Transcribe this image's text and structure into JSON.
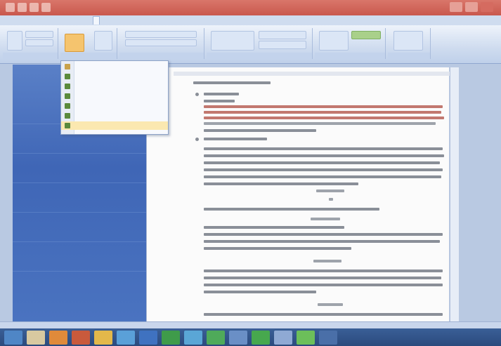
{
  "window": {
    "title": "",
    "quick_access_icons": [
      "save-icon",
      "undo-icon",
      "redo-icon",
      "print-icon"
    ]
  },
  "ribbon": {
    "tabs": [
      {
        "label": "",
        "name": "tab-home"
      },
      {
        "label": "",
        "name": "tab-insert"
      },
      {
        "label": "",
        "name": "tab-page-layout"
      },
      {
        "label": "",
        "name": "tab-references"
      },
      {
        "label": "",
        "name": "tab-mailings"
      },
      {
        "label": "",
        "name": "tab-review"
      },
      {
        "label": "",
        "name": "tab-view"
      }
    ],
    "active_tab_index": 4
  },
  "dropdown_menu": {
    "items": [
      {
        "label": "",
        "icon": "page-icon"
      },
      {
        "label": "",
        "icon": "page-icon"
      },
      {
        "label": "",
        "icon": "page-icon"
      },
      {
        "label": "",
        "icon": "page-icon"
      },
      {
        "label": "",
        "icon": "page-icon"
      },
      {
        "label": "",
        "icon": "page-icon"
      },
      {
        "label": "",
        "icon": "page-icon"
      }
    ]
  },
  "document": {
    "has_red_highlighted_text": true
  },
  "status": {
    "text": ""
  },
  "colors": {
    "title_bar": "#c9584d",
    "ribbon": "#cfdcef",
    "left_panel": "#3f66b6",
    "taskbar": "#2b4a7d",
    "menu_highlight": "#fbe8b0",
    "accent_orange": "#f5c46e"
  },
  "taskbar": {
    "apps": [
      "start-icon",
      "explorer-icon",
      "media-icon",
      "firefox-icon",
      "folder-icon",
      "ie-icon",
      "word-icon",
      "excel-icon",
      "skype-icon",
      "chrome-icon",
      "app-icon",
      "excel-icon",
      "app-icon",
      "app-icon",
      "app-icon"
    ]
  }
}
